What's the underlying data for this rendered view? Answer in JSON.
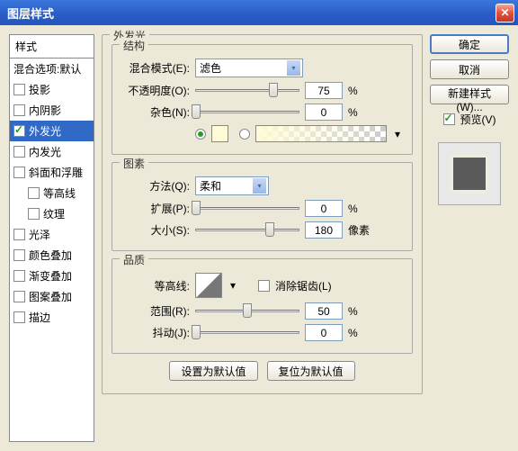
{
  "title": "图层样式",
  "styles_header": "样式",
  "styles_list": [
    {
      "label": "混合选项:默认",
      "checked": null,
      "indent": false
    },
    {
      "label": "投影",
      "checked": false,
      "indent": false
    },
    {
      "label": "内阴影",
      "checked": false,
      "indent": false
    },
    {
      "label": "外发光",
      "checked": true,
      "indent": false,
      "selected": true
    },
    {
      "label": "内发光",
      "checked": false,
      "indent": false
    },
    {
      "label": "斜面和浮雕",
      "checked": false,
      "indent": false
    },
    {
      "label": "等高线",
      "checked": false,
      "indent": true
    },
    {
      "label": "纹理",
      "checked": false,
      "indent": true
    },
    {
      "label": "光泽",
      "checked": false,
      "indent": false
    },
    {
      "label": "颜色叠加",
      "checked": false,
      "indent": false
    },
    {
      "label": "渐变叠加",
      "checked": false,
      "indent": false
    },
    {
      "label": "图案叠加",
      "checked": false,
      "indent": false
    },
    {
      "label": "描边",
      "checked": false,
      "indent": false
    }
  ],
  "panel_title": "外发光",
  "group_struct": "结构",
  "group_elem": "图素",
  "group_qual": "品质",
  "labels": {
    "blend_mode": "混合模式(E):",
    "opacity": "不透明度(O):",
    "noise": "杂色(N):",
    "technique": "方法(Q):",
    "spread": "扩展(P):",
    "size": "大小(S):",
    "contour": "等高线:",
    "antialias": "消除锯齿(L)",
    "range": "范围(R):",
    "jitter": "抖动(J):"
  },
  "values": {
    "blend_mode": "滤色",
    "technique": "柔和",
    "opacity": "75",
    "noise": "0",
    "spread": "0",
    "size": "180",
    "range": "50",
    "jitter": "0"
  },
  "units": {
    "percent": "%",
    "px": "像素"
  },
  "buttons": {
    "ok": "确定",
    "cancel": "取消",
    "new_style": "新建样式(W)...",
    "preview": "预览(V)",
    "set_default": "设置为默认值",
    "reset_default": "复位为默认值"
  },
  "slider_positions": {
    "opacity": 75,
    "noise": 0,
    "spread": 0,
    "size": 72,
    "range": 50,
    "jitter": 0
  }
}
